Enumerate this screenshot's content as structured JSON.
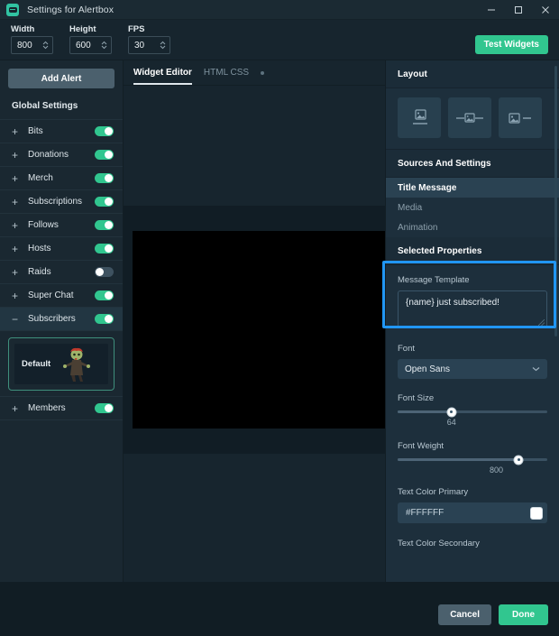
{
  "window": {
    "title": "Settings for Alertbox",
    "icon": "app-logo-icon",
    "minimize": "minimize-icon",
    "maximize": "maximize-icon",
    "close": "close-icon"
  },
  "toolbar": {
    "fields": [
      {
        "label": "Width",
        "value": "800"
      },
      {
        "label": "Height",
        "value": "600"
      },
      {
        "label": "FPS",
        "value": "30"
      }
    ],
    "test_widgets_label": "Test Widgets"
  },
  "sidebar": {
    "add_alert_label": "Add Alert",
    "global_settings_label": "Global Settings",
    "items": [
      {
        "label": "Bits",
        "sign": "+",
        "enabled": true,
        "expanded": false
      },
      {
        "label": "Donations",
        "sign": "+",
        "enabled": true,
        "expanded": false
      },
      {
        "label": "Merch",
        "sign": "+",
        "enabled": true,
        "expanded": false
      },
      {
        "label": "Subscriptions",
        "sign": "+",
        "enabled": true,
        "expanded": false
      },
      {
        "label": "Follows",
        "sign": "+",
        "enabled": true,
        "expanded": false
      },
      {
        "label": "Hosts",
        "sign": "+",
        "enabled": true,
        "expanded": false
      },
      {
        "label": "Raids",
        "sign": "+",
        "enabled": false,
        "expanded": false
      },
      {
        "label": "Super Chat",
        "sign": "+",
        "enabled": true,
        "expanded": false
      },
      {
        "label": "Subscribers",
        "sign": "−",
        "enabled": true,
        "expanded": true
      }
    ],
    "preset": {
      "name": "Default",
      "thumbnail": "zombie-character-image"
    },
    "members": {
      "label": "Members",
      "sign": "+",
      "enabled": true
    }
  },
  "center": {
    "tabs": [
      {
        "label": "Widget Editor",
        "active": true
      },
      {
        "label": "HTML CSS",
        "active": false
      }
    ],
    "tab_indicator": "unsaved-dot-icon"
  },
  "right_panel": {
    "layout": {
      "title": "Layout",
      "options": [
        {
          "name": "layout-image-above-text",
          "icon": "image-over-line-icon"
        },
        {
          "name": "layout-text-inline",
          "icon": "line-image-line-icon"
        },
        {
          "name": "layout-image-left-text",
          "icon": "image-left-line-icon"
        }
      ]
    },
    "sources": {
      "title": "Sources And Settings",
      "items": [
        {
          "label": "Title Message",
          "selected": true
        },
        {
          "label": "Media",
          "selected": false
        },
        {
          "label": "Animation",
          "selected": false
        }
      ],
      "highlight_color": "#2196f3"
    },
    "properties": {
      "title": "Selected Properties",
      "message_template": {
        "label": "Message Template",
        "value": "{name} just subscribed!"
      },
      "font": {
        "label": "Font",
        "value": "Open Sans"
      },
      "font_size": {
        "label": "Font Size",
        "value": "64",
        "percent": 36
      },
      "font_weight": {
        "label": "Font Weight",
        "value": "800",
        "percent": 81
      },
      "text_color_primary": {
        "label": "Text Color Primary",
        "value": "#FFFFFF",
        "swatch": "#FFFFFF"
      },
      "text_color_secondary": {
        "label": "Text Color Secondary"
      }
    }
  },
  "footer": {
    "cancel_label": "Cancel",
    "done_label": "Done"
  },
  "theme": {
    "accent_green": "#31c68f",
    "highlight_blue": "#2196f3",
    "panel_bg": "#1d2f3c",
    "sidebar_bg": "#1a2831"
  }
}
